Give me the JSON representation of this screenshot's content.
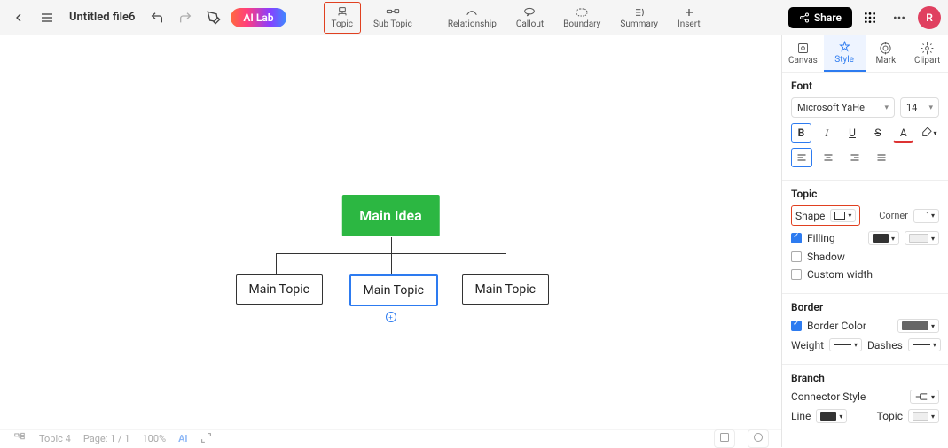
{
  "header": {
    "filename": "Untitled file6",
    "ai_lab": "AI Lab",
    "tools": [
      {
        "id": "topic",
        "label": "Topic",
        "highlight": true
      },
      {
        "id": "subtopic",
        "label": "Sub Topic"
      },
      {
        "id": "relationship",
        "label": "Relationship"
      },
      {
        "id": "callout",
        "label": "Callout"
      },
      {
        "id": "boundary",
        "label": "Boundary"
      },
      {
        "id": "summary",
        "label": "Summary"
      },
      {
        "id": "insert",
        "label": "Insert"
      }
    ],
    "share": "Share",
    "avatar": "R"
  },
  "canvas": {
    "central": "Main Idea",
    "topics": [
      "Main Topic",
      "Main Topic",
      "Main Topic"
    ],
    "selected_index": 1
  },
  "panel": {
    "tabs": [
      "Canvas",
      "Style",
      "Mark",
      "Clipart"
    ],
    "active_tab": 1,
    "font": {
      "heading": "Font",
      "family": "Microsoft YaHe",
      "size": "14"
    },
    "bold": "B",
    "italic": "I",
    "underline": "U",
    "strike": "S",
    "textcolor": "A",
    "topic_heading": "Topic",
    "shape_label": "Shape",
    "corner_label": "Corner",
    "filling_label": "Filling",
    "shadow_label": "Shadow",
    "customwidth_label": "Custom width",
    "border_heading": "Border",
    "bordercolor_label": "Border Color",
    "weight_label": "Weight",
    "dashes_label": "Dashes",
    "branch_heading": "Branch",
    "connector_label": "Connector Style",
    "line_label": "Line",
    "topiclbl": "Topic",
    "filling_checked": true,
    "bordercolor_checked": true
  },
  "bottom": {
    "topic": "Topic 4",
    "page": "Page: 1 / 1",
    "zoom": "100%",
    "ai": "AI"
  }
}
